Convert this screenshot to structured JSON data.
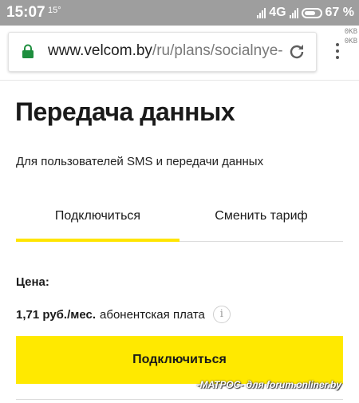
{
  "status_bar": {
    "time": "15:07",
    "temperature": "15°",
    "network": "4G",
    "battery": "67 %"
  },
  "browser": {
    "url_host": "www.velcom.by",
    "url_path": "/ru/plans/socialnye-",
    "data_meter": [
      "0KB",
      "0KB"
    ],
    "lock_color": "#1e8e3e"
  },
  "page": {
    "title": "Передача данных",
    "subtitle": "Для пользователей SMS и передачи данных",
    "tabs": [
      {
        "label": "Подключиться",
        "active": true
      },
      {
        "label": "Сменить тариф",
        "active": false
      }
    ],
    "price_label": "Цена:",
    "price_value": "1,71 руб./мес.",
    "price_note": "абонентская плата",
    "info_glyph": "i",
    "connect_button": "Подключиться",
    "accent_color": "#ffe900"
  },
  "watermark": "-МАТРОС- для forum.onliner.by"
}
